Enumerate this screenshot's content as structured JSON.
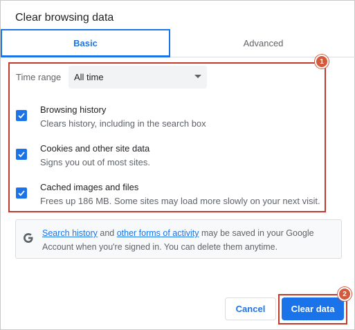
{
  "dialog": {
    "title": "Clear browsing data"
  },
  "tabs": [
    {
      "label": "Basic",
      "selected": true
    },
    {
      "label": "Advanced",
      "selected": false
    }
  ],
  "time_range": {
    "label": "Time range",
    "value": "All time"
  },
  "options": [
    {
      "title": "Browsing history",
      "description": "Clears history, including in the search box",
      "checked": true
    },
    {
      "title": "Cookies and other site data",
      "description": "Signs you out of most sites.",
      "checked": true
    },
    {
      "title": "Cached images and files",
      "description": "Frees up 186 MB. Some sites may load more slowly on your next visit.",
      "checked": true
    }
  ],
  "info": {
    "link1": "Search history",
    "text1": " and ",
    "link2": "other forms of activity",
    "text2": " may be saved in your Google Account when you're signed in. You can delete them anytime."
  },
  "buttons": {
    "cancel": "Cancel",
    "clear": "Clear data"
  },
  "annotations": {
    "badge1": "1",
    "badge2": "2"
  },
  "colors": {
    "accent": "#1a73e8",
    "annotation": "#c0392b",
    "badge": "#d35a3c"
  },
  "icons": {
    "checkbox": "check-icon",
    "dropdown": "caret-down-icon",
    "google": "google-g-icon"
  }
}
